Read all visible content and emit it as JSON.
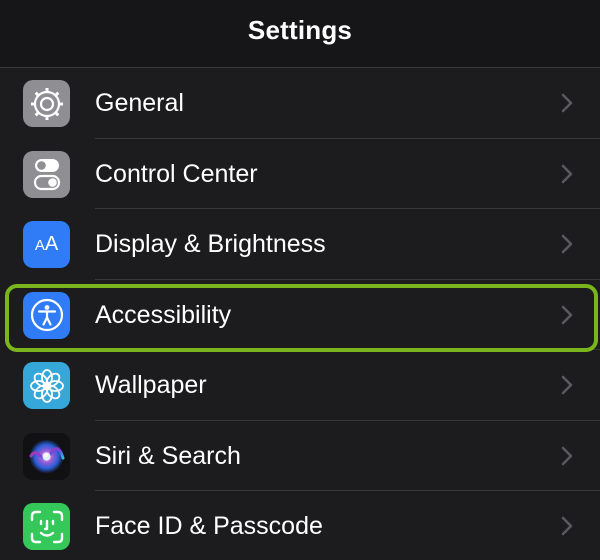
{
  "header": {
    "title": "Settings"
  },
  "items": [
    {
      "label": "General",
      "icon": "gear-icon",
      "color": "#8e8e93"
    },
    {
      "label": "Control Center",
      "icon": "toggles-icon",
      "color": "#8e8e93"
    },
    {
      "label": "Display & Brightness",
      "icon": "text-size-icon",
      "color": "#2f7cf6"
    },
    {
      "label": "Accessibility",
      "icon": "accessibility-icon",
      "color": "#2f7cf6",
      "highlighted": true
    },
    {
      "label": "Wallpaper",
      "icon": "flower-icon",
      "color": "#35a7d9"
    },
    {
      "label": "Siri & Search",
      "icon": "siri-icon",
      "color": "#111114"
    },
    {
      "label": "Face ID & Passcode",
      "icon": "face-id-icon",
      "color": "#34c759"
    }
  ],
  "display_icon_text": {
    "big": "A",
    "small": "A"
  },
  "colors": {
    "highlight": "#7ab51d",
    "background": "#1c1c1e",
    "separator": "#38383a"
  }
}
